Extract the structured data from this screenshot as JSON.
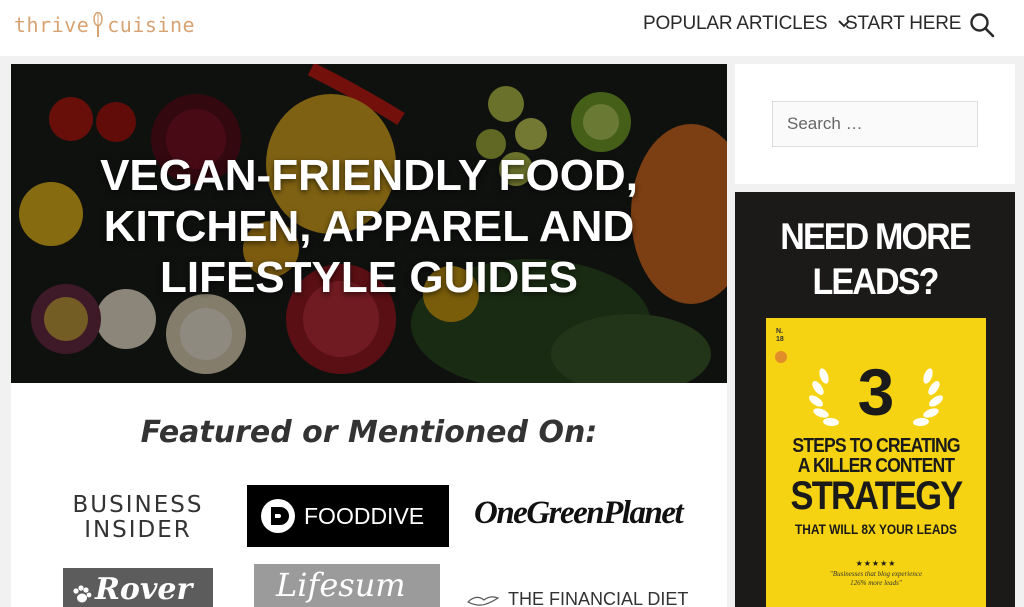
{
  "header": {
    "logo_left": "thrive",
    "logo_right": "cuisine",
    "nav": {
      "popular": "POPULAR ARTICLES",
      "start": "START HERE"
    }
  },
  "hero": {
    "title": "VEGAN-FRIENDLY FOOD,\nKITCHEN, APPAREL AND\nLIFESTYLE GUIDES"
  },
  "featured": {
    "title": "Featured or Mentioned On:",
    "logos": {
      "business_insider": "BUSINESS\nINSIDER",
      "food_dive": "FOODDIVE",
      "one_green_planet": "OneGreenPlanet",
      "rover": "Rover",
      "lifesum": "Lifesum",
      "financial_diet": "THE FINANCIAL DIET"
    }
  },
  "sidebar": {
    "search_placeholder": "Search …",
    "ad": {
      "headline": "NEED MORE\nLEADS?",
      "book": {
        "issue": "N.\n18",
        "number": "3",
        "line1": "STEPS TO CREATING\nA KILLER CONTENT",
        "strategy": "STRATEGY",
        "sub": "THAT WILL 8X YOUR LEADS",
        "stars": "★★★★★",
        "quote": "\"Businesses that blog experience\n126% more leads\""
      }
    }
  },
  "colors": {
    "logo": "#d8a373",
    "ad_bg": "#1c1a19",
    "book": "#f5d312"
  }
}
